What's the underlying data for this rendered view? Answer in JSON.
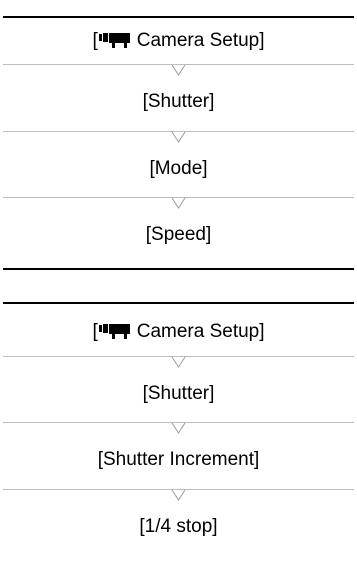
{
  "menu_paths": [
    {
      "steps": [
        {
          "label": "Camera Setup]",
          "prefix": "[",
          "icon": "movie-camera-icon"
        },
        {
          "label": "[Shutter]"
        },
        {
          "label": "[Mode]"
        },
        {
          "label": "[Speed]"
        }
      ]
    },
    {
      "steps": [
        {
          "label": "Camera Setup]",
          "prefix": "[",
          "icon": "movie-camera-icon"
        },
        {
          "label": "[Shutter]"
        },
        {
          "label": "[Shutter Increment]"
        },
        {
          "label": "[1/4 stop]"
        }
      ]
    }
  ]
}
